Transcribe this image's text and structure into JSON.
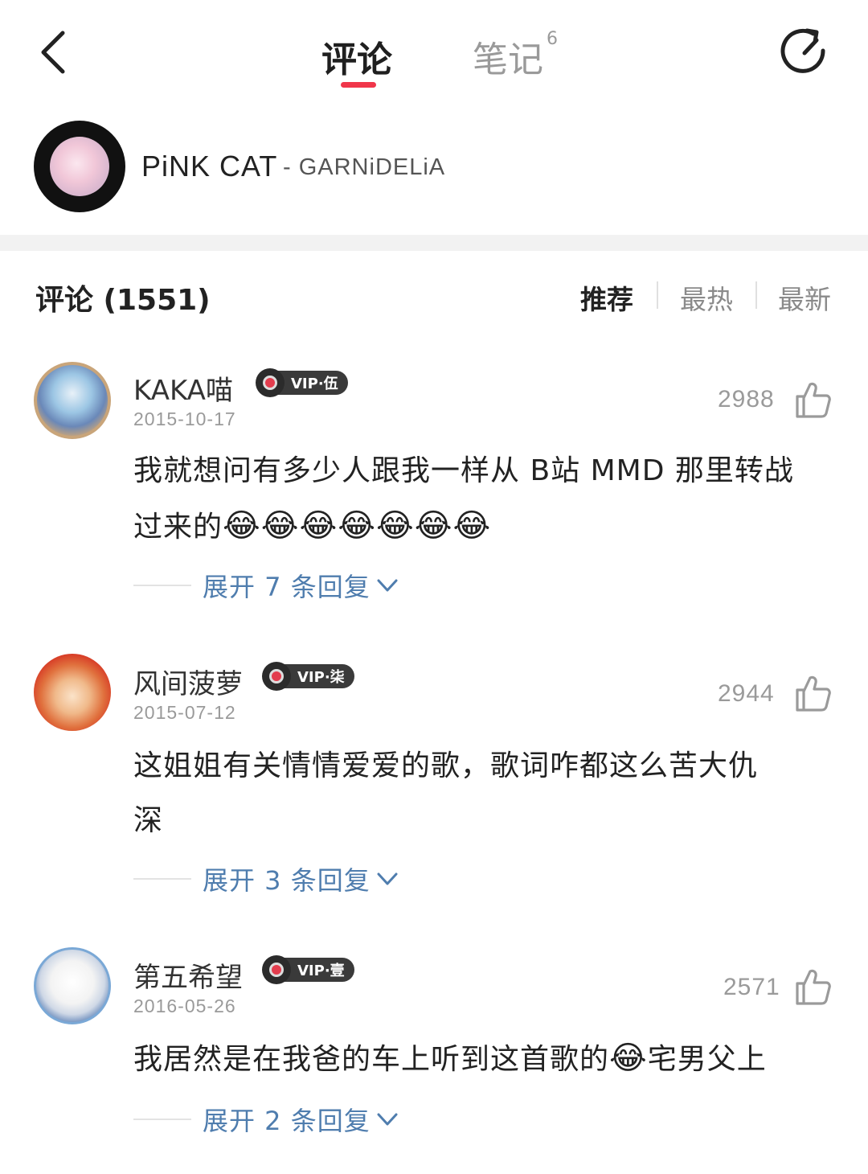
{
  "top_bar": {
    "tab_comments": "评论",
    "tab_notes": "笔记",
    "tab_notes_count": "6"
  },
  "song": {
    "title": "PiNK CAT",
    "artist": "- GARNiDELiA"
  },
  "comments_header": {
    "title": "评论 (1551)",
    "sort_recommended": "推荐",
    "sort_hot": "最热",
    "sort_new": "最新"
  },
  "comments": [
    {
      "username": "KAKA喵",
      "vip": "VIP·伍",
      "date": "2015-10-17",
      "likes": "2988",
      "text_line1": "我就想问有多少人跟我一样从 B站 MMD 那里转战",
      "text_line2": "过来的",
      "emojis": "😂😂😂😂😂😂😂",
      "replies": "展开 7 条回复"
    },
    {
      "username": "风间菠萝",
      "vip": "VIP·柒",
      "date": "2015-07-12",
      "likes": "2944",
      "text_line1": "这姐姐有关情情爱爱的歌，歌词咋都这么苦大仇",
      "text_line2": "深",
      "replies": "展开 3 条回复"
    },
    {
      "username": "第五希望",
      "vip": "VIP·壹",
      "date": "2016-05-26",
      "likes": "2571",
      "text_before": "我居然是在我爸的车上听到这首歌的",
      "emoji": "😂",
      "text_after": "宅男父上",
      "replies": "展开 2 条回复"
    }
  ],
  "colors": {
    "accent": "#f0364a",
    "reply_link": "#4f7dae",
    "muted": "#9a9a9a"
  }
}
